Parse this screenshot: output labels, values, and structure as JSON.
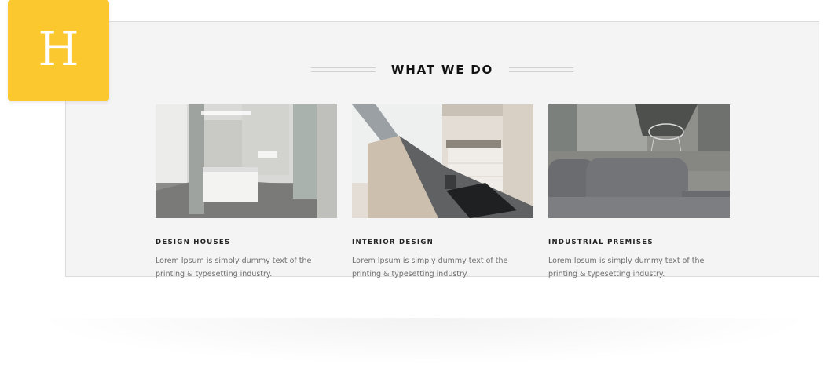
{
  "logo": {
    "letter": "H"
  },
  "section": {
    "title": "WHAT WE DO"
  },
  "cards": [
    {
      "title": "DESIGN HOUSES",
      "text": "Lorem Ipsum is simply dummy text of the printing & typesetting industry."
    },
    {
      "title": "INTERIOR DESIGN",
      "text": "Lorem Ipsum is simply dummy text of the printing & typesetting industry."
    },
    {
      "title": "INDUSTRIAL PREMISES",
      "text": "Lorem Ipsum is simply dummy text of the printing & typesetting industry."
    }
  ],
  "colors": {
    "accent": "#fcc82f",
    "panel_background": "#f4f4f4",
    "panel_border": "#dcdcdc",
    "heading_text": "#111111",
    "body_text": "#6e6e6e"
  }
}
